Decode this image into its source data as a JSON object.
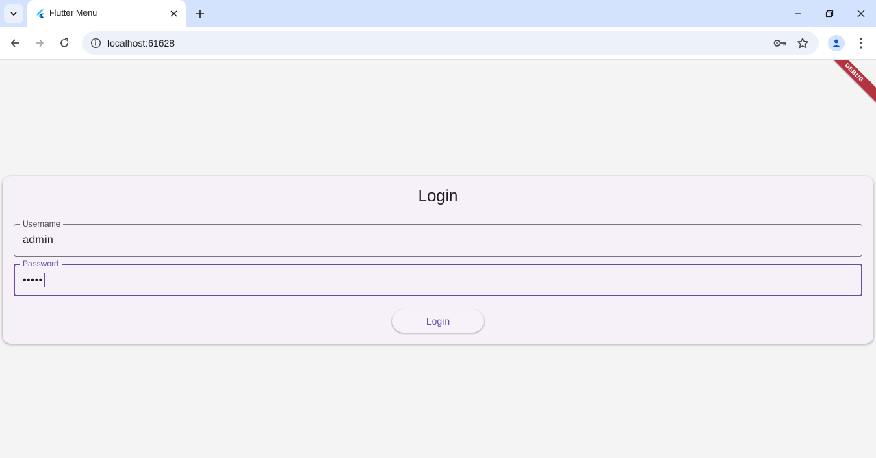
{
  "browser": {
    "tab_title": "Flutter Menu",
    "url": "localhost:61628"
  },
  "page": {
    "debug_banner": "DEBUG",
    "card_title": "Login",
    "username": {
      "label": "Username",
      "value": "admin"
    },
    "password": {
      "label": "Password",
      "value": "•••••"
    },
    "login_button": "Login"
  },
  "colors": {
    "accent": "#6750a4",
    "card_bg": "#f6f1f8",
    "tabbar_bg": "#d3e3fd",
    "debug_banner": "#b3343f"
  }
}
